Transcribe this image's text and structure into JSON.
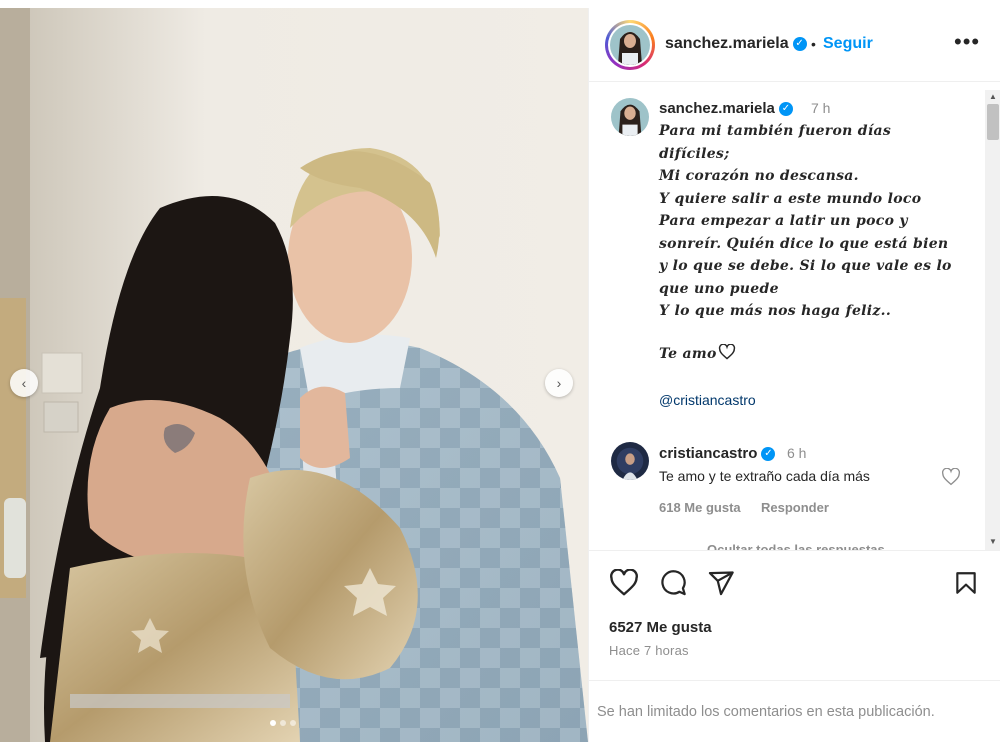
{
  "post": {
    "username": "sanchez.mariela",
    "follow_label": "Seguir",
    "separator": "•",
    "more_icon": "more-horizontal-icon",
    "verified_mark": "✓"
  },
  "caption": {
    "username": "sanchez.mariela",
    "time": "7 h",
    "lines": [
      "Para mi también fueron días",
      "difíciles;",
      "Mi corazón no descansa.",
      "Y quiere salir a este mundo loco",
      "Para empezar a latir un poco y",
      "sonreír. Quién dice lo que está bien",
      "y lo que se debe. Si lo que vale es lo",
      "que uno puede",
      "Y lo que más nos haga feliz..",
      "Te amo"
    ],
    "mention": "@cristiancastro"
  },
  "comment": {
    "username": "cristiancastro",
    "time": "6 h",
    "text": "Te amo y te extraño cada día más",
    "likes": "618 Me gusta",
    "reply_label": "Responder",
    "hide_replies_label": "Ocultar todas las respuestas"
  },
  "actions": {
    "icons": [
      "heart-icon",
      "comment-icon",
      "share-icon",
      "bookmark-icon"
    ],
    "likes_total": "6527 Me gusta",
    "posted": "Hace 7 horas"
  },
  "footer": {
    "limited_text": "Se han limitado los comentarios en esta publicación."
  },
  "carousel": {
    "prev_symbol": "‹",
    "next_symbol": "›"
  },
  "colors": {
    "link_blue": "#0095f6",
    "mention_blue": "#00376b",
    "muted_gray": "#8e8e8e",
    "text": "#262626"
  }
}
